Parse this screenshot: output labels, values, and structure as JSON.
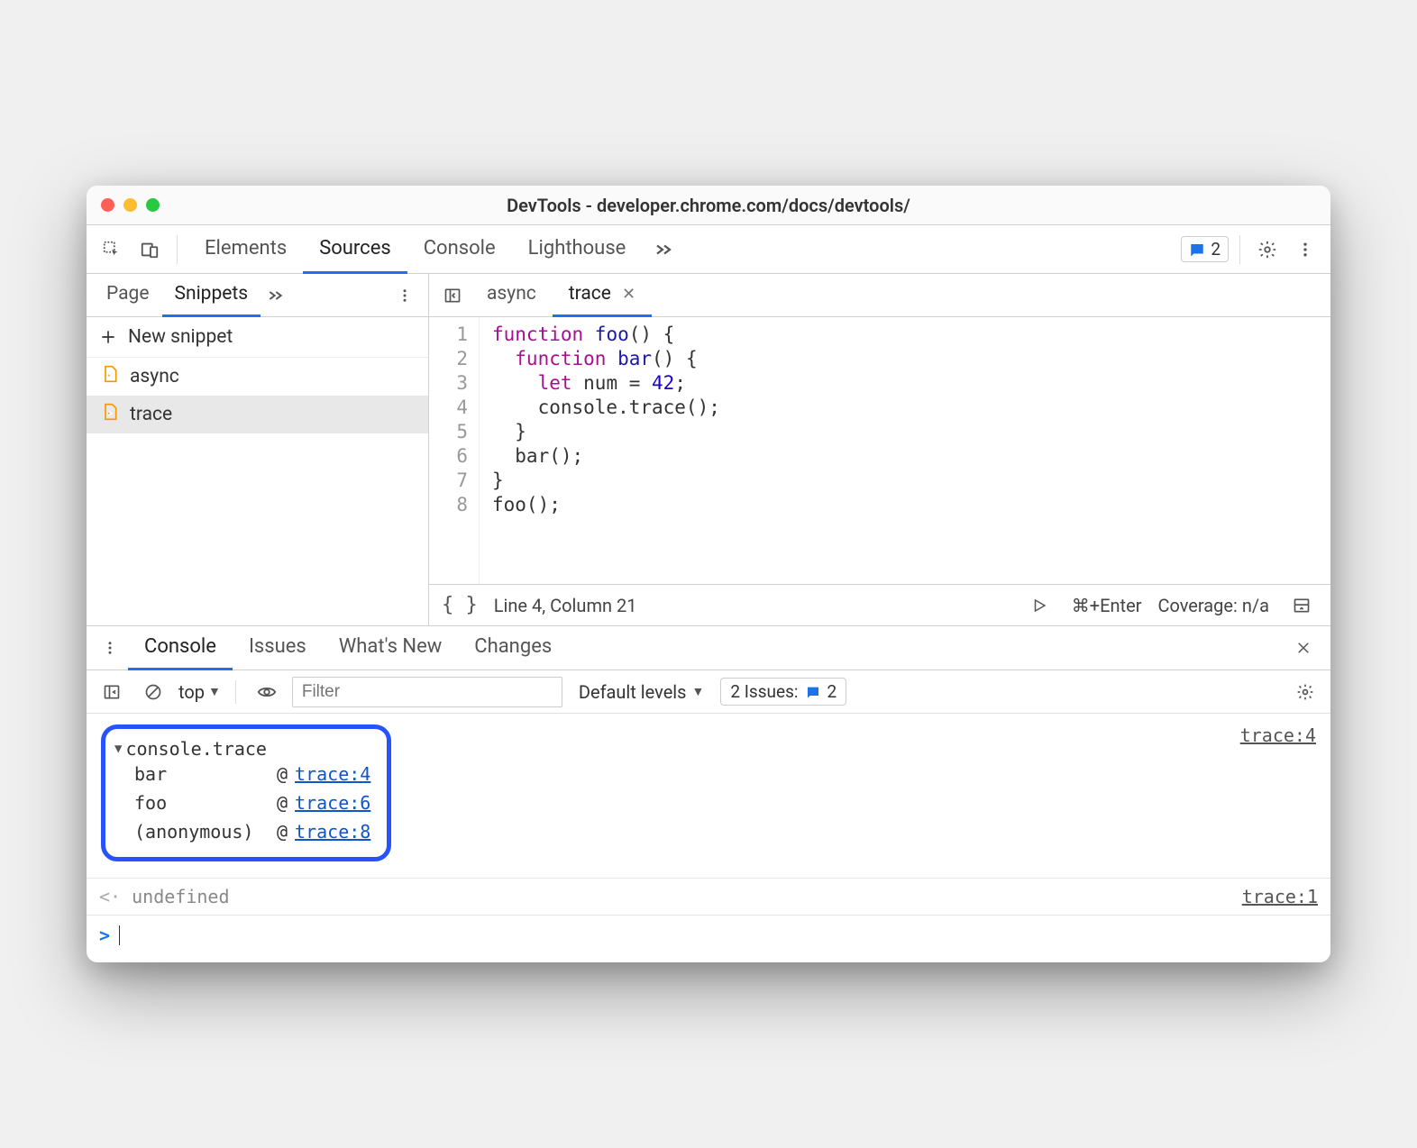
{
  "window": {
    "title": "DevTools - developer.chrome.com/docs/devtools/"
  },
  "mainTabs": {
    "items": [
      "Elements",
      "Sources",
      "Console",
      "Lighthouse"
    ],
    "active": "Sources",
    "issuesCount": "2"
  },
  "navigator": {
    "tabs": [
      "Page",
      "Snippets"
    ],
    "active": "Snippets",
    "newLabel": "New snippet",
    "files": [
      "async",
      "trace"
    ],
    "selected": "trace"
  },
  "editor": {
    "tabs": [
      "async",
      "trace"
    ],
    "active": "trace",
    "gutter": [
      "1",
      "2",
      "3",
      "4",
      "5",
      "6",
      "7",
      "8"
    ],
    "status": {
      "pos": "Line 4, Column 21",
      "run": "⌘+Enter",
      "coverage": "Coverage: n/a"
    }
  },
  "code": {
    "l1a": "function ",
    "l1b": "foo",
    "l1c": "() {",
    "l2a": "  function ",
    "l2b": "bar",
    "l2c": "() {",
    "l3a": "    let ",
    "l3b": "num",
    "l3c": " = ",
    "l3d": "42",
    "l3e": ";",
    "l4": "    console.trace();",
    "l5": "  }",
    "l6": "  bar();",
    "l7": "}",
    "l8": "foo();"
  },
  "drawer": {
    "tabs": [
      "Console",
      "Issues",
      "What's New",
      "Changes"
    ],
    "active": "Console"
  },
  "consoleToolbar": {
    "context": "top",
    "filterPlaceholder": "Filter",
    "levels": "Default levels",
    "issuesLabel": "2 Issues:",
    "issuesCount": "2"
  },
  "consoleOutput": {
    "traceHeader": "console.trace",
    "traceSource": "trace:4",
    "stack": [
      {
        "fn": "bar",
        "loc": "trace:4"
      },
      {
        "fn": "foo",
        "loc": "trace:6"
      },
      {
        "fn": "(anonymous)",
        "loc": "trace:8"
      }
    ],
    "undefLabel": "undefined",
    "undefSource": "trace:1"
  }
}
